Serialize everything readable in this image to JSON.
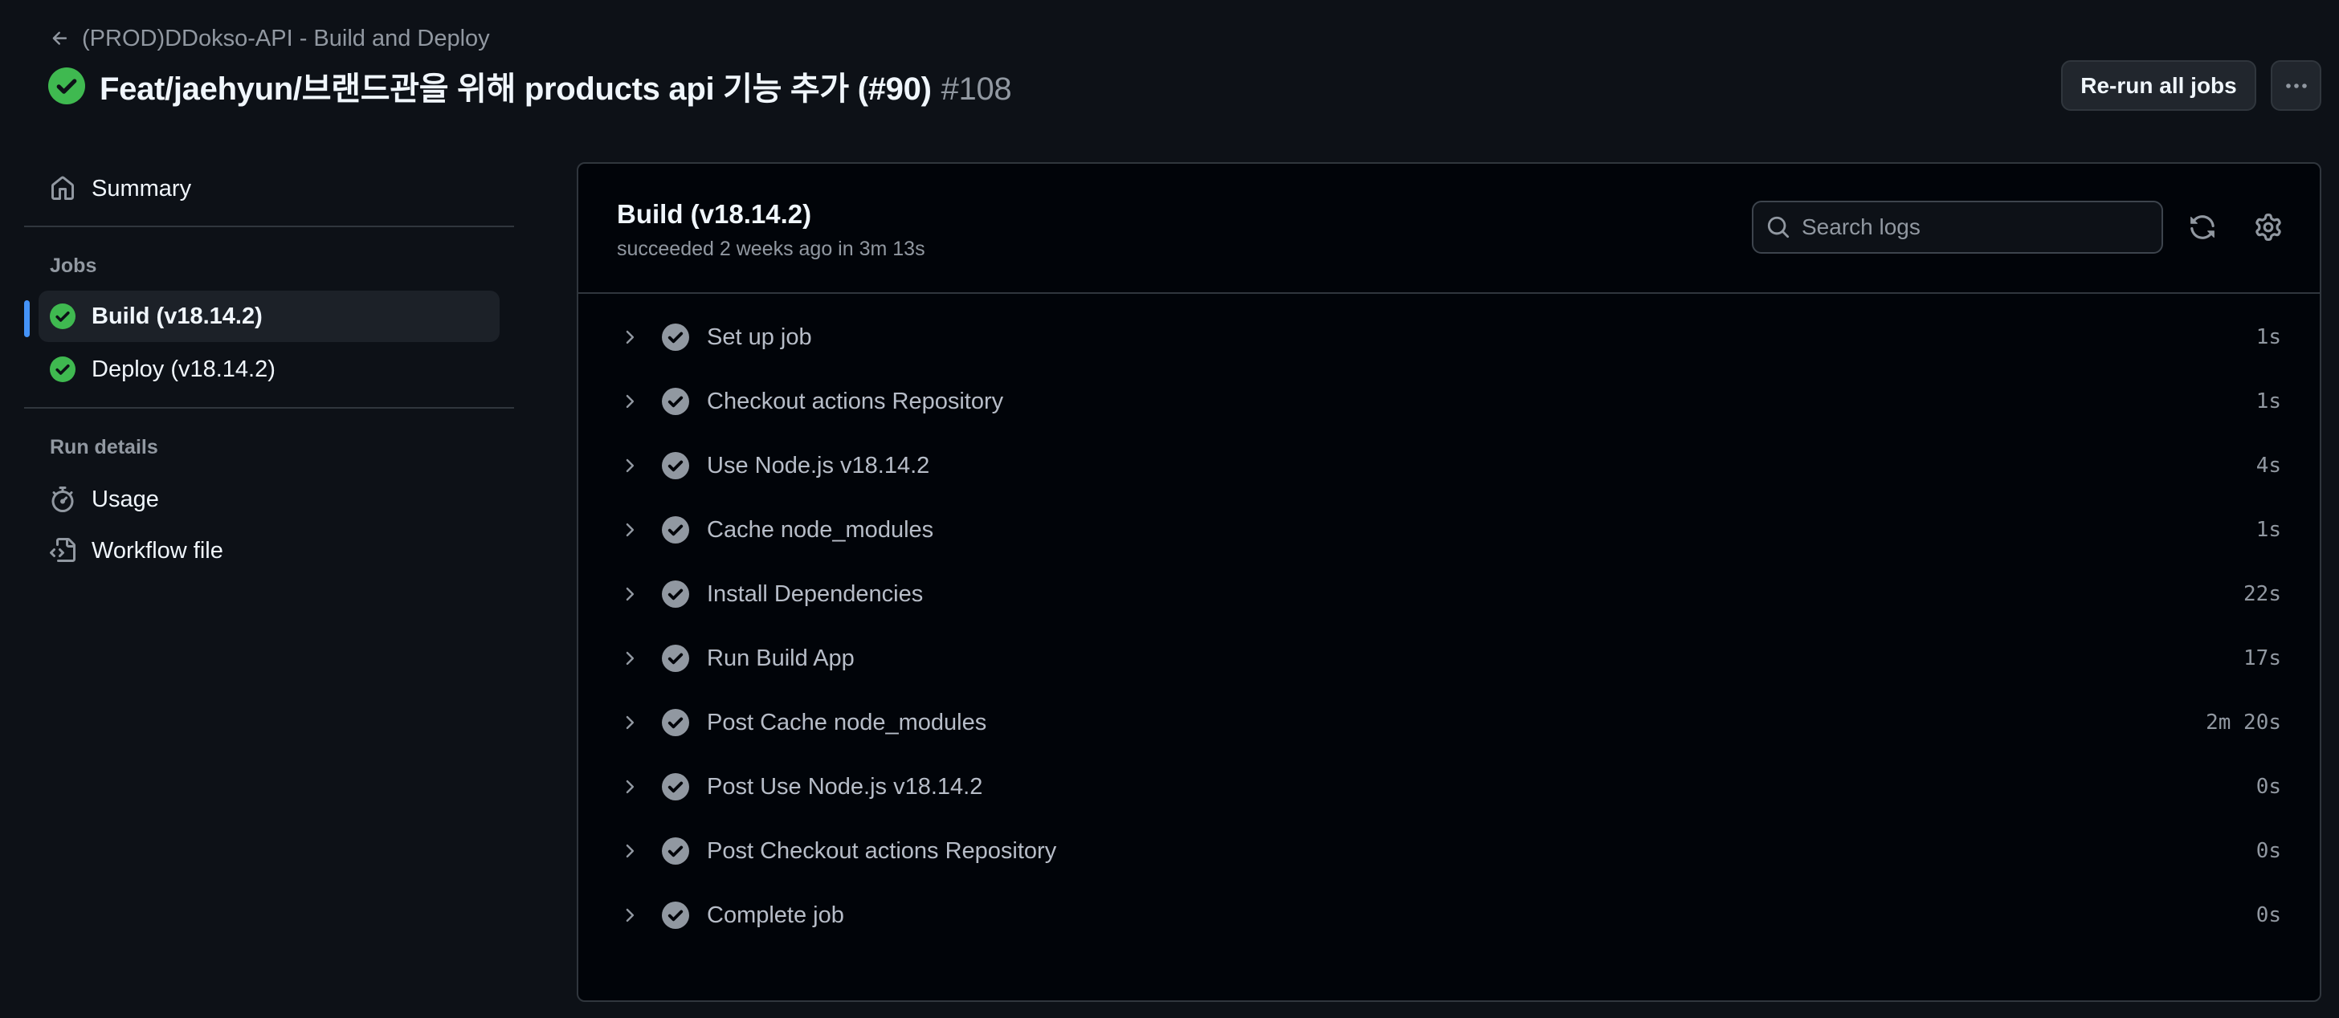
{
  "header": {
    "back_label": "(PROD)DDokso-API - Build and Deploy",
    "title": "Feat/jaehyun/브랜드관을 위해 products api 기능 추가 (#90)",
    "run_number": "#108",
    "rerun_label": "Re-run all jobs"
  },
  "sidebar": {
    "summary_label": "Summary",
    "jobs_heading": "Jobs",
    "jobs": [
      {
        "label": "Build (v18.14.2)",
        "status": "success",
        "active": true
      },
      {
        "label": "Deploy (v18.14.2)",
        "status": "success",
        "active": false
      }
    ],
    "run_details_heading": "Run details",
    "usage_label": "Usage",
    "workflow_label": "Workflow file"
  },
  "job": {
    "title": "Build (v18.14.2)",
    "subtitle": "succeeded 2 weeks ago in 3m 13s",
    "search_placeholder": "Search logs",
    "steps": [
      {
        "name": "Set up job",
        "duration": "1s"
      },
      {
        "name": "Checkout actions Repository",
        "duration": "1s"
      },
      {
        "name": "Use Node.js v18.14.2",
        "duration": "4s"
      },
      {
        "name": "Cache node_modules",
        "duration": "1s"
      },
      {
        "name": "Install Dependencies",
        "duration": "22s"
      },
      {
        "name": "Run Build App",
        "duration": "17s"
      },
      {
        "name": "Post Cache node_modules",
        "duration": "2m 20s"
      },
      {
        "name": "Post Use Node.js v18.14.2",
        "duration": "0s"
      },
      {
        "name": "Post Checkout actions Repository",
        "duration": "0s"
      },
      {
        "name": "Complete job",
        "duration": "0s"
      }
    ]
  },
  "colors": {
    "success_green": "#3fb950",
    "accent_blue": "#4493f8",
    "background": "#0d1117",
    "panel_background": "#010409"
  },
  "icons": {
    "back": "arrow-left-icon",
    "run_status": "check-circle-fill-icon",
    "more": "kebab-horizontal-icon",
    "summary": "home-icon",
    "usage": "stopwatch-icon",
    "workflow": "file-code-icon",
    "search": "search-icon",
    "refresh": "sync-icon",
    "settings": "gear-icon",
    "step_expand": "chevron-right-icon",
    "step_status": "check-circle-fill-icon"
  }
}
